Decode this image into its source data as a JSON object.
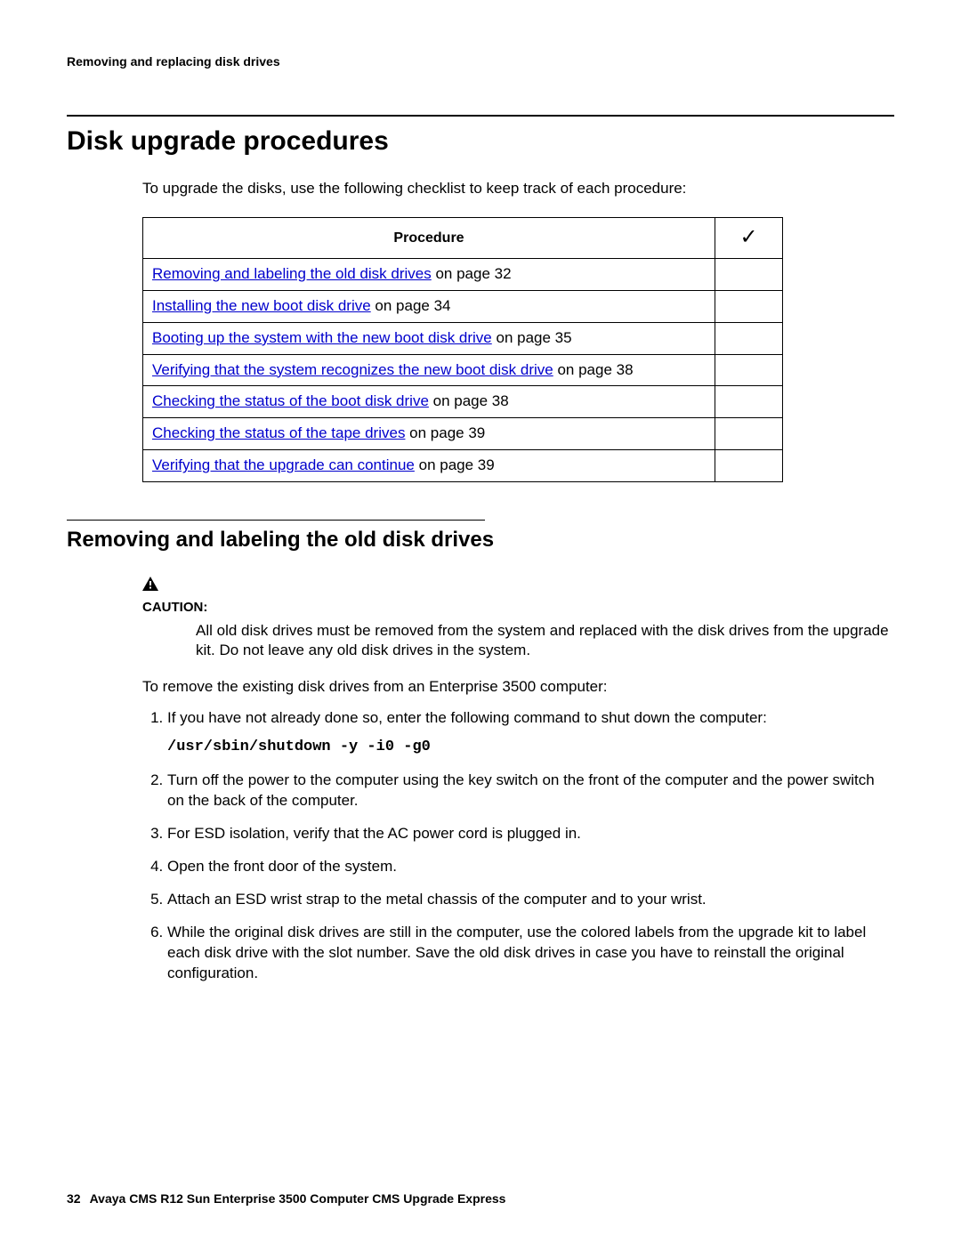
{
  "running_header": "Removing and replacing disk drives",
  "section_title": "Disk upgrade procedures",
  "intro": "To upgrade the disks, use the following checklist to keep track of each procedure:",
  "table": {
    "col_procedure": "Procedure",
    "col_check": "✓",
    "rows": [
      {
        "link": "Removing and labeling the old disk drives",
        "suffix": " on page 32"
      },
      {
        "link": "Installing the new boot disk drive",
        "suffix": " on page 34"
      },
      {
        "link": "Booting up the system with the new boot disk drive",
        "suffix": " on page 35"
      },
      {
        "link": "Verifying that the system recognizes the new boot disk drive",
        "suffix": " on page 38"
      },
      {
        "link": "Checking the status of the boot disk drive",
        "suffix": " on page 38"
      },
      {
        "link": "Checking the status of the tape drives",
        "suffix": " on page 39"
      },
      {
        "link": "Verifying that the upgrade can continue",
        "suffix": " on page 39"
      }
    ]
  },
  "subheading": "Removing and labeling the old disk drives",
  "caution_label": "CAUTION:",
  "caution_text": "All old disk drives must be removed from the system and replaced with the disk drives from the upgrade kit. Do not leave any old disk drives in the system.",
  "lead_in": "To remove the existing disk drives from an Enterprise 3500 computer:",
  "steps": {
    "s1": "If you have not already done so, enter the following command to shut down the computer:",
    "s1_cmd": "/usr/sbin/shutdown -y -i0 -g0",
    "s2": "Turn off the power to the computer using the key switch on the front of the computer and the power switch on the back of the computer.",
    "s3": "For ESD isolation, verify that the AC power cord is plugged in.",
    "s4": "Open the front door of the system.",
    "s5": "Attach an ESD wrist strap to the metal chassis of the computer and to your wrist.",
    "s6": "While the original disk drives are still in the computer, use the colored labels from the upgrade kit to label each disk drive with the slot number. Save the old disk drives in case you have to reinstall the original configuration."
  },
  "footer": {
    "page_number": "32",
    "doc_title": "Avaya CMS R12 Sun Enterprise 3500 Computer CMS Upgrade Express"
  }
}
